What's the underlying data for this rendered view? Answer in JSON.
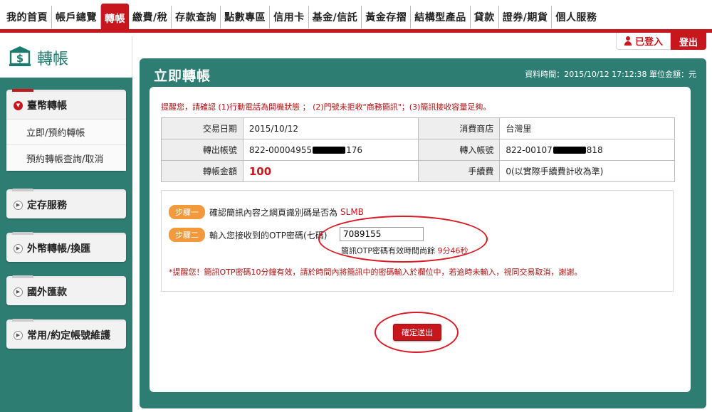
{
  "nav": {
    "items": [
      "我的首頁",
      "帳戶總覽",
      "轉帳",
      "繳費/稅",
      "存款查詢",
      "點數專區",
      "信用卡",
      "基金/信託",
      "黃金存摺",
      "結構型產品",
      "貸款",
      "證券/期貨",
      "個人服務"
    ],
    "active_index": 2
  },
  "auth": {
    "logged_in_label": "已登入",
    "logout_label": "登出"
  },
  "sidebar": {
    "title": "轉帳",
    "sections": [
      {
        "label": "臺幣轉帳",
        "open": true,
        "items": [
          "立即/預約轉帳",
          "預約轉帳查詢/取消"
        ]
      },
      {
        "label": "定存服務",
        "open": false
      },
      {
        "label": "外幣轉帳/換匯",
        "open": false
      },
      {
        "label": "國外匯款",
        "open": false
      },
      {
        "label": "常用/約定帳號維護",
        "open": false
      }
    ]
  },
  "main": {
    "title": "立即轉帳",
    "info": "資料時間：2015/10/12 17:12:38 單位金額：元",
    "notice": "提醒您，請確認 (1)行動電話為開機狀態 ； (2)門號未拒收\"商務簡訊\"；(3)簡訊接收容量足夠。",
    "table": {
      "trade_date_label": "交易日期",
      "trade_date": "2015/10/12",
      "merchant_label": "消費商店",
      "merchant": "台灣里",
      "from_label": "轉出帳號",
      "from_prefix": "822-00004955",
      "from_suffix": "176",
      "to_label": "轉入帳號",
      "to_prefix": "822-00107",
      "to_suffix": "818",
      "amount_label": "轉帳金額",
      "amount": "100",
      "fee_label": "手續費",
      "fee": "0(以實際手續費計收為準)"
    },
    "steps": {
      "step1_pill": "步驟一",
      "step1_text": "確認簡訊內容之網頁識別碼是否為",
      "step1_code": "SLMB",
      "step2_pill": "步驟二",
      "step2_text": "輸入您接收到的OTP密碼(七碼)",
      "otp_value": "7089155",
      "otp_hint": "簡訊OTP密碼有效時間尚餘",
      "otp_remaining": "9分46秒",
      "warning": "*提醒您！簡訊OTP密碼10分鐘有效，請於時間內將簡訊中的密碼輸入於欄位中，若逾時未輸入，視同交易取消，謝謝。"
    },
    "submit_label": "確定送出"
  },
  "colors": {
    "brand_red": "#c8161d",
    "teal": "#2e7d72",
    "step_orange": "#f29a3b",
    "annotation_red": "#d81b25"
  }
}
